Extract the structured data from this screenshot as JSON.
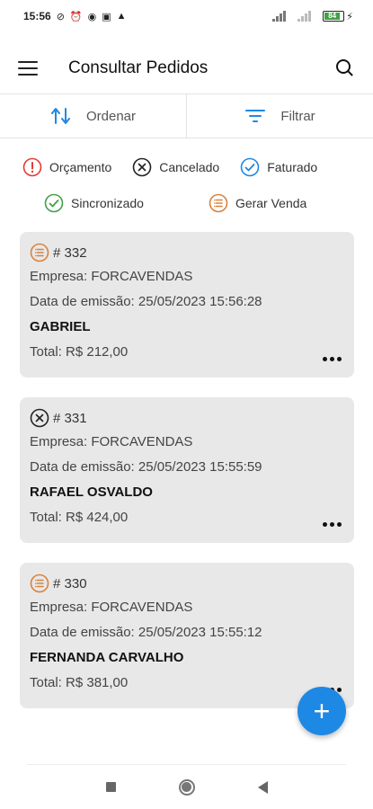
{
  "status_bar": {
    "time": "15:56",
    "battery": "84"
  },
  "app_bar": {
    "title": "Consultar Pedidos"
  },
  "toolbar": {
    "sort_label": "Ordenar",
    "filter_label": "Filtrar"
  },
  "legend": [
    {
      "label": "Orçamento",
      "icon": "exclamation-circle-icon",
      "color": "#e53935"
    },
    {
      "label": "Cancelado",
      "icon": "x-circle-icon",
      "color": "#222222"
    },
    {
      "label": "Faturado",
      "icon": "check-circle-icon",
      "color": "#1e88e5"
    },
    {
      "label": "Sincronizado",
      "icon": "check-circle-icon",
      "color": "#43a047"
    },
    {
      "label": "Gerar Venda",
      "icon": "list-circle-icon",
      "color": "#d9823b"
    }
  ],
  "orders": [
    {
      "number": "# 332",
      "status_icon": "list-circle-icon",
      "company": "Empresa: FORCAVENDAS",
      "date": "Data de emissão: 25/05/2023 15:56:28",
      "client": "GABRIEL",
      "total": "Total: R$ 212,00"
    },
    {
      "number": "# 331",
      "status_icon": "x-circle-icon",
      "company": "Empresa: FORCAVENDAS",
      "date": "Data de emissão: 25/05/2023 15:55:59",
      "client": "RAFAEL OSVALDO",
      "total": "Total: R$ 424,00"
    },
    {
      "number": "# 330",
      "status_icon": "list-circle-icon",
      "company": "Empresa: FORCAVENDAS",
      "date": "Data de emissão: 25/05/2023 15:55:12",
      "client": "FERNANDA CARVALHO",
      "total": "Total: R$ 381,00"
    }
  ],
  "fab": {
    "label": "+",
    "color": "#1e88e5"
  }
}
